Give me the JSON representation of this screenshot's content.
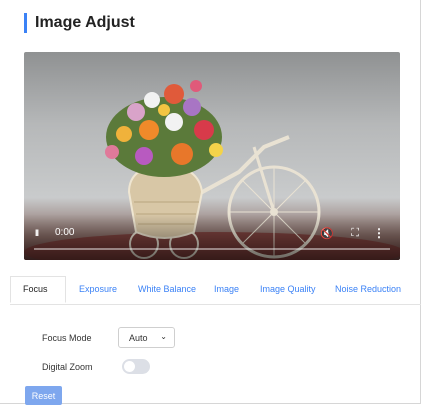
{
  "header": {
    "title": "Image Adjust"
  },
  "player": {
    "time": "0:00",
    "play_icon": "II",
    "progress": 0
  },
  "tabs": [
    {
      "label": "Focus",
      "active": true
    },
    {
      "label": "Exposure",
      "active": false
    },
    {
      "label": "White Balance",
      "active": false
    },
    {
      "label": "Image",
      "active": false
    },
    {
      "label": "Image Quality",
      "active": false
    },
    {
      "label": "Noise Reduction",
      "active": false
    }
  ],
  "form": {
    "focus_mode_label": "Focus Mode",
    "focus_mode_value": "Auto",
    "digital_zoom_label": "Digital Zoom",
    "digital_zoom_on": false
  },
  "buttons": {
    "reset_label": "Reset"
  },
  "colors": {
    "accent": "#3b82f6",
    "reset_bg": "#7ea7ee",
    "toggle_off": "#dcdfe6"
  }
}
